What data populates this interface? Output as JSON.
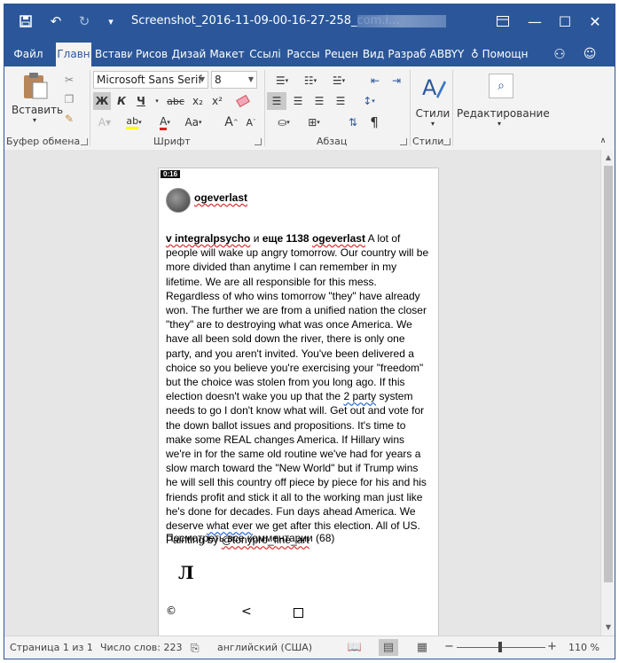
{
  "titlebar": {
    "title": "Screenshot_2016-11-09-00-16-27-258_com.i...",
    "save_icon": "save-icon",
    "undo_icon": "undo-icon",
    "redo_icon": "redo-icon",
    "qat_icon": "customize-qat-icon",
    "restore_ribbon_icon": "ribbon-display-icon",
    "minimize": "—",
    "maximize": "☐",
    "close": "✕"
  },
  "tabs": [
    {
      "label": "Файл"
    },
    {
      "label": "Главн"
    },
    {
      "label": "Встави"
    },
    {
      "label": "Рисов"
    },
    {
      "label": "Дизай"
    },
    {
      "label": "Макет"
    },
    {
      "label": "Ссылі"
    },
    {
      "label": "Рассы"
    },
    {
      "label": "Рецен"
    },
    {
      "label": "Вид"
    },
    {
      "label": "Разраб"
    },
    {
      "label": "ABBYY"
    }
  ],
  "tellme": "Помощн",
  "ribbon": {
    "clipboard": {
      "paste_label": "Вставить",
      "group_label": "Буфер обмена"
    },
    "font": {
      "name": "Microsoft Sans Serif",
      "size": "8",
      "bold": "Ж",
      "italic": "К",
      "underline": "Ч",
      "strike": "abc",
      "subscript": "x₂",
      "superscript": "x²",
      "grow": "A",
      "shrink": "A",
      "case": "Aa",
      "group_label": "Шрифт"
    },
    "paragraph": {
      "group_label": "Абзац",
      "pilcrow": "¶"
    },
    "styles": {
      "button_label": "Стили",
      "group_label": "Стили"
    },
    "editing": {
      "button_label": "Редактирование"
    }
  },
  "document": {
    "time": "0:16",
    "username": "ogeverlast",
    "mention1": "v integralpsycho",
    "and": " и ",
    "more": "еще 1138",
    "username2": "ogeverlast",
    "para_a": " A lot of people will wake up angry tomorrow. Our country will be more divided than anytime I can remember in my lifetime. We are all responsible for this mess. Regardless of who wins tomorrow \"they\" have already won. The further we are from a unified nation the closer \"they\" are to destroying what was once America. We have all been sold down the river, there is only one party, and you aren't invited. You've been delivered a choice so you believe you're exercising your \"freedom\" but the choice was stolen from you long ago. If this election doesn't wake you up that the ",
    "two_party": "2 party",
    "para_b": " system needs to go I don't know what will. Get out and vote for the down ballot issues and propositions. It's time to make some REAL changes America. If Hillary wins we're in for the same old routine we've had for years a slow march toward the \"New World\" but if Trump wins he will sell this country off piece by piece for his and his friends profit and stick it all to the working man just like he's done for decades. Fun days ahead America. We deserve ",
    "whatever": "what ever",
    "para_c": " we get after this election. All of US. Painting by ",
    "handle": "@tonypro_fine_art",
    "comments": "Посмотреть все комментарии (68)",
    "glyph": "Л",
    "nav_copy": "©",
    "nav_back": "<"
  },
  "statusbar": {
    "page": "Страница 1 из 1",
    "words": "Число слов: 223",
    "language": "английский (США)",
    "zoom": "110 %",
    "minus": "−",
    "plus": "+"
  }
}
